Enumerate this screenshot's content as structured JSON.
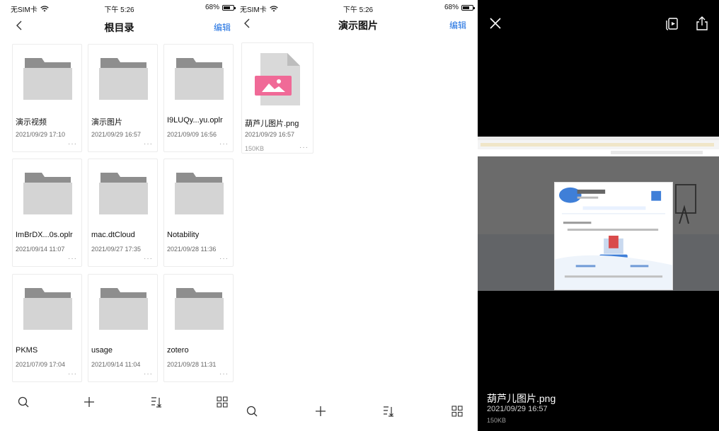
{
  "screen1": {
    "status": {
      "carrier": "无SIM卡",
      "time": "下午 5:26",
      "battery": "68%"
    },
    "nav": {
      "title": "根目录",
      "edit": "编辑"
    },
    "items": [
      {
        "name": "演示视频",
        "date": "2021/09/29 17:10",
        "more": "···"
      },
      {
        "name": "演示图片",
        "date": "2021/09/29 16:57",
        "more": "···"
      },
      {
        "name": "I9LUQy...yu.oplr",
        "date": "2021/09/09 16:56",
        "more": "···"
      },
      {
        "name": "ImBrDX...0s.oplr",
        "date": "2021/09/14 11:07",
        "more": "···"
      },
      {
        "name": "mac.dtCloud",
        "date": "2021/09/27 17:35",
        "more": "···"
      },
      {
        "name": "Notability",
        "date": "2021/09/28 11:36",
        "more": "···"
      },
      {
        "name": "PKMS",
        "date": "2021/07/09 17:04",
        "more": "···"
      },
      {
        "name": "usage",
        "date": "2021/09/14 11:04",
        "more": "···"
      },
      {
        "name": "zotero",
        "date": "2021/09/28 11:31",
        "more": "···"
      }
    ],
    "toolbar": {
      "icons": [
        "search-icon",
        "plus-icon",
        "sort-icon",
        "grid-icon"
      ]
    }
  },
  "screen2": {
    "status": {
      "carrier": "无SIM卡",
      "time": "下午 5:26",
      "battery": "68%"
    },
    "nav": {
      "title": "演示图片",
      "edit": "编辑"
    },
    "file": {
      "name": "葫芦儿图片.png",
      "date": "2021/09/29 16:57",
      "size": "150KB",
      "more": "···"
    },
    "toolbar": {
      "icons": [
        "search-icon",
        "plus-icon",
        "sort-icon",
        "grid-icon"
      ]
    }
  },
  "viewer": {
    "file_name": "葫芦儿图片.png",
    "date": "2021/09/29 16:57",
    "size": "150KB",
    "icons": [
      "close-icon",
      "slideshow-icon",
      "share-icon"
    ]
  },
  "colors": {
    "accent": "#1d6fe0",
    "folder_back": "#8e8e8e",
    "folder_front": "#d4d4d4",
    "image_thumb": "#f06a97",
    "viewer_bg": "#000000"
  }
}
